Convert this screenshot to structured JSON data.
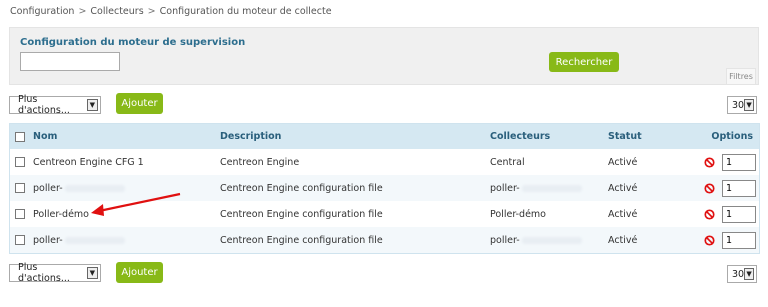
{
  "breadcrumb": [
    "Configuration",
    "Collecteurs",
    "Configuration du moteur de collecte"
  ],
  "breadcrumb_separator": ">",
  "filter": {
    "title": "Configuration du moteur de supervision",
    "search_value": "",
    "search_button": "Rechercher",
    "filters_tab": "Filtres"
  },
  "toolbar_top": {
    "actions_label": "Plus d'actions...",
    "add_label": "Ajouter",
    "limit": "30"
  },
  "toolbar_bottom": {
    "actions_label": "Plus d'actions...",
    "add_label": "Ajouter",
    "limit": "30"
  },
  "table": {
    "columns": [
      "Nom",
      "Description",
      "Collecteurs",
      "Statut",
      "Options"
    ],
    "rows": [
      {
        "name": "Centreon Engine CFG 1",
        "description": "Centreon Engine",
        "collector": "Central",
        "status": "Activé",
        "option": "1"
      },
      {
        "name": "poller-",
        "description": "Centreon Engine configuration file",
        "collector": "poller-",
        "status": "Activé",
        "option": "1"
      },
      {
        "name": "Poller-démo",
        "description": "Centreon Engine configuration file",
        "collector": "Poller-démo",
        "status": "Activé",
        "option": "1"
      },
      {
        "name": "poller-",
        "description": "Centreon Engine configuration file",
        "collector": "poller-",
        "status": "Activé",
        "option": "1"
      }
    ]
  },
  "colors": {
    "accent_green": "#88b917",
    "header_blue": "#d5e8f2",
    "title_blue": "#2d6e8e",
    "annotation_red": "#e01010"
  },
  "icons": {
    "select_arrow": "chevron-down-icon",
    "disable": "disable-icon",
    "annotation": "red-arrow-annotation"
  }
}
